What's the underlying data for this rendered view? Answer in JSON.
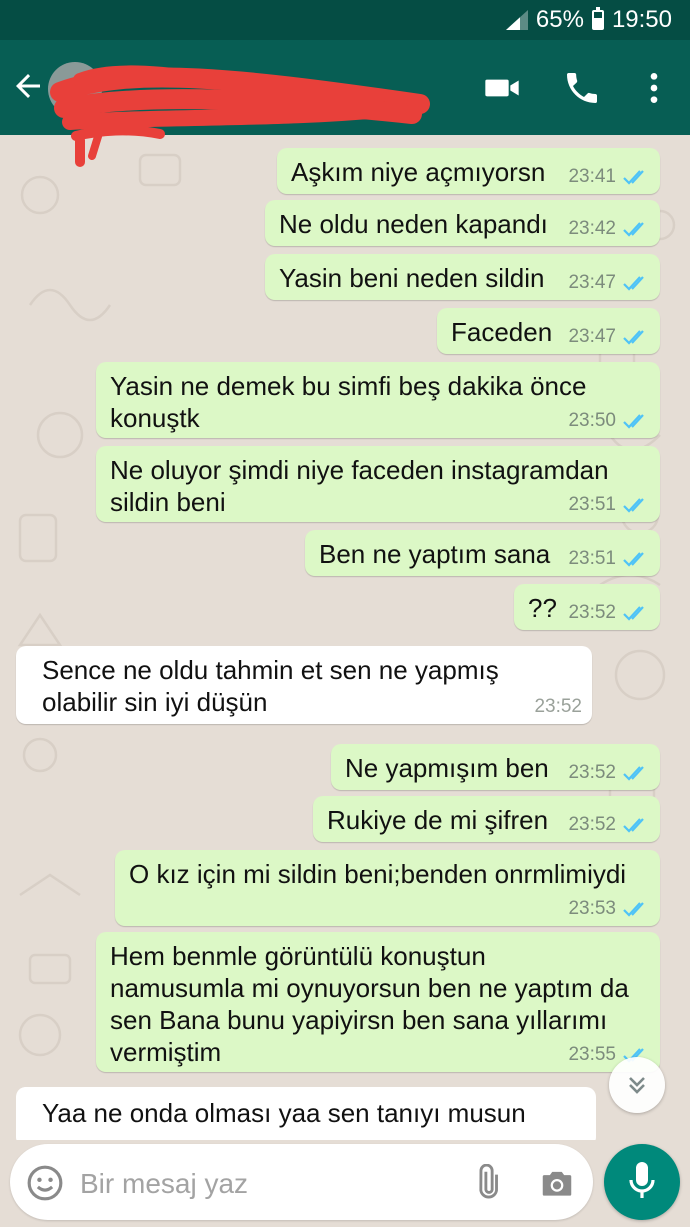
{
  "status_bar": {
    "battery": "65%",
    "time": "19:50",
    "battery_level": 0.65
  },
  "header": {
    "contact_name": ""
  },
  "compose": {
    "placeholder": "Bir mesaj yaz"
  },
  "messages": [
    {
      "direction": "out",
      "text": "Aşkım niye açmıyorsn",
      "time": "23:41"
    },
    {
      "direction": "out",
      "text": "Ne oldu neden kapandı",
      "time": "23:42"
    },
    {
      "direction": "out",
      "text": "Yasin beni neden sildin",
      "time": "23:47"
    },
    {
      "direction": "out",
      "text": "Faceden",
      "time": "23:47"
    },
    {
      "direction": "out",
      "text": "Yasin ne demek bu simfi beş dakika önce\nkonuştk",
      "time": "23:50"
    },
    {
      "direction": "out",
      "text": "Ne oluyor şimdi niye faceden instagramdan\nsildin beni",
      "time": "23:51"
    },
    {
      "direction": "out",
      "text": "Ben ne yaptım sana",
      "time": "23:51"
    },
    {
      "direction": "out",
      "text": "??",
      "time": "23:52"
    },
    {
      "direction": "in",
      "text": "Sence ne oldu tahmin et sen ne yapmış\nolabilir sin iyi düşün",
      "time": "23:52"
    },
    {
      "direction": "out",
      "text": "Ne yapmışım ben",
      "time": "23:52"
    },
    {
      "direction": "out",
      "text": "Rukiye de mi şifren",
      "time": "23:52"
    },
    {
      "direction": "out",
      "text": "O kız için mi sildin beni;benden onrmlimiydi",
      "time": "23:53"
    },
    {
      "direction": "out",
      "text": "Hem benmle görüntülü konuştun\nnamusumla mi oynuyorsun ben ne yaptım da\nsen Bana bunu yapiyirsn ben sana yıllarımı\nvermiştim",
      "time": "23:55"
    },
    {
      "direction": "in",
      "text": "Yaa ne onda olması yaa sen tanıyı musun",
      "time": ""
    }
  ],
  "colors": {
    "status_bar": "#054d44",
    "app_bar": "#075e54",
    "chat_background": "#e5ddd5",
    "outgoing_bubble": "#dcf8c6",
    "incoming_bubble": "#ffffff",
    "read_ticks": "#4fc3f7",
    "mic_button": "#00897b"
  },
  "icons": [
    "back-arrow-icon",
    "video-call-icon",
    "phone-icon",
    "more-vert-icon",
    "emoji-icon",
    "attach-icon",
    "camera-icon",
    "mic-icon",
    "chevron-double-down-icon"
  ]
}
